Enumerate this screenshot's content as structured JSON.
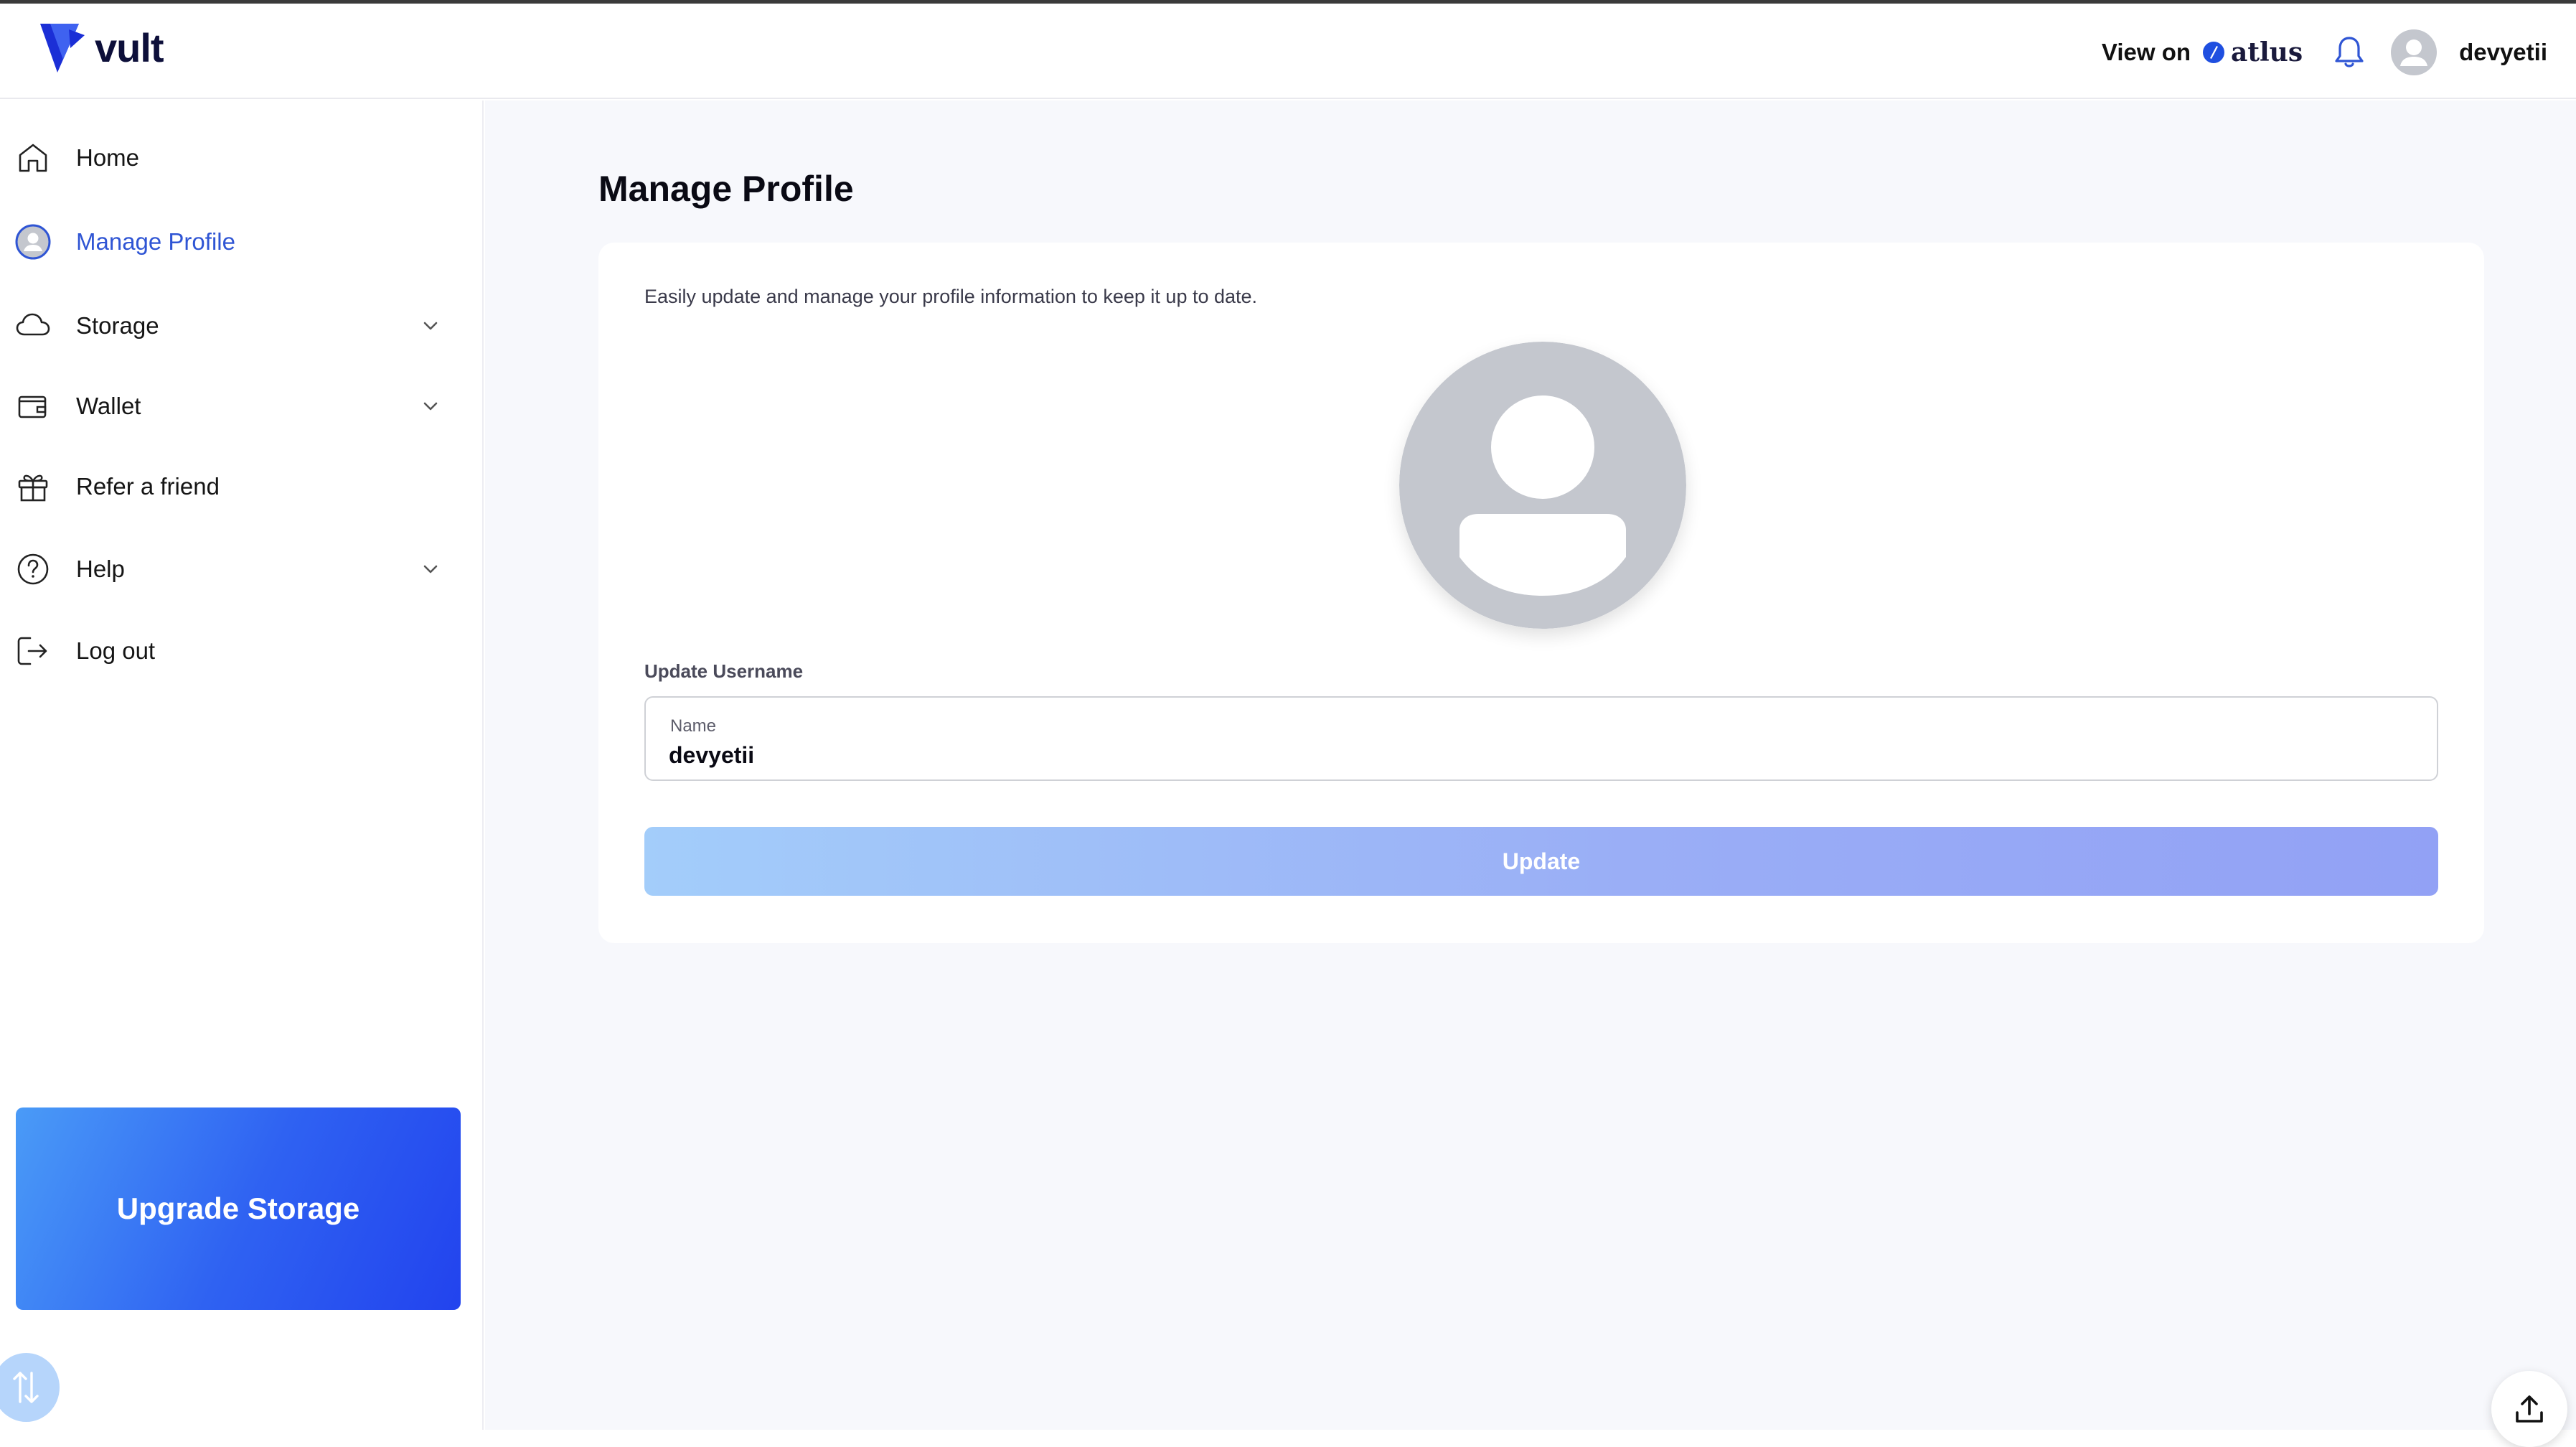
{
  "app": {
    "name": "vult"
  },
  "header": {
    "view_on_label": "View on",
    "partner_name": "atlus",
    "username": "devyetii"
  },
  "sidebar": {
    "items": [
      {
        "label": "Home",
        "icon": "home-icon",
        "active": false
      },
      {
        "label": "Manage Profile",
        "icon": "user-avatar-icon",
        "active": true
      },
      {
        "label": "Storage",
        "icon": "cloud-icon",
        "expandable": true
      },
      {
        "label": "Wallet",
        "icon": "wallet-icon",
        "expandable": true
      },
      {
        "label": "Refer a friend",
        "icon": "gift-icon"
      },
      {
        "label": "Help",
        "icon": "help-circle-icon",
        "expandable": true
      },
      {
        "label": "Log out",
        "icon": "logout-icon"
      }
    ],
    "upgrade_label": "Upgrade Storage"
  },
  "main": {
    "title": "Manage Profile",
    "description": "Easily update and manage your profile information to keep it up to date.",
    "section_label": "Update Username",
    "name_field": {
      "label": "Name",
      "value": "devyetii"
    },
    "update_button": "Update"
  },
  "colors": {
    "accent": "#2f55d4",
    "brand": "#1a2fd6",
    "upgrade_gradient_start": "#4a9bf7",
    "upgrade_gradient_end": "#2243ee",
    "update_button_start": "#a3cdfa",
    "update_button_end": "#92a1f5",
    "avatar_gray": "#c4c7ce"
  }
}
